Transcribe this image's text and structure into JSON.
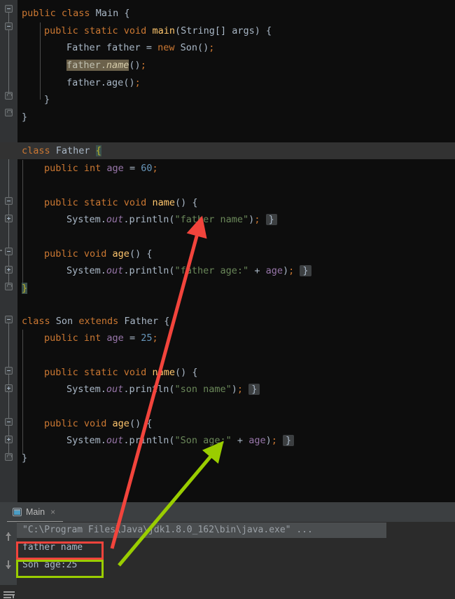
{
  "editor": {
    "language": "java",
    "background": "#0D0D0D",
    "gutter_background": "#313335",
    "current_line": "class Father {",
    "lines": [
      {
        "n": 1,
        "indent": 0,
        "text": "public class Main {"
      },
      {
        "n": 2,
        "indent": 1,
        "text": "public static void main(String[] args) {"
      },
      {
        "n": 3,
        "indent": 2,
        "text": "Father father = new Son();"
      },
      {
        "n": 4,
        "indent": 2,
        "text": "father.name();"
      },
      {
        "n": 5,
        "indent": 2,
        "text": "father.age();"
      },
      {
        "n": 6,
        "indent": 1,
        "text": "}"
      },
      {
        "n": 7,
        "indent": 0,
        "text": "}"
      },
      {
        "n": 8,
        "indent": 0,
        "text": ""
      },
      {
        "n": 9,
        "indent": 0,
        "text": "class Father {"
      },
      {
        "n": 10,
        "indent": 1,
        "text": "public int age = 60;"
      },
      {
        "n": 11,
        "indent": 0,
        "text": ""
      },
      {
        "n": 12,
        "indent": 1,
        "text": "public static void name() {"
      },
      {
        "n": 13,
        "indent": 2,
        "text": "System.out.println(\"father name\"); }"
      },
      {
        "n": 14,
        "indent": 0,
        "text": ""
      },
      {
        "n": 15,
        "indent": 1,
        "text": "public void age() {"
      },
      {
        "n": 16,
        "indent": 2,
        "text": "System.out.println(\"father age:\" + age); }"
      },
      {
        "n": 17,
        "indent": 0,
        "text": "}"
      },
      {
        "n": 18,
        "indent": 0,
        "text": ""
      },
      {
        "n": 19,
        "indent": 0,
        "text": "class Son extends Father {"
      },
      {
        "n": 20,
        "indent": 1,
        "text": "public int age = 25;"
      },
      {
        "n": 21,
        "indent": 0,
        "text": ""
      },
      {
        "n": 22,
        "indent": 1,
        "text": "public static void name() {"
      },
      {
        "n": 23,
        "indent": 2,
        "text": "System.out.println(\"son name\"); }"
      },
      {
        "n": 24,
        "indent": 0,
        "text": ""
      },
      {
        "n": 25,
        "indent": 1,
        "text": "public void age() {"
      },
      {
        "n": 26,
        "indent": 2,
        "text": "System.out.println(\"Son age:\" + age); }"
      },
      {
        "n": 27,
        "indent": 0,
        "text": "}"
      }
    ],
    "highlighted_token": "father.name",
    "field_values": {
      "father_age": "60",
      "son_age": "25"
    },
    "strings": [
      "father name",
      "father age:",
      "son name",
      "Son age:"
    ]
  },
  "console": {
    "tab_label": "Main",
    "tab_close_glyph": "×",
    "lines": [
      {
        "text": "\"C:\\Program Files\\Java\\jdk1.8.0_162\\bin\\java.exe\" ...",
        "kind": "system"
      },
      {
        "text": "father name",
        "kind": "output"
      },
      {
        "text": "Son age:25",
        "kind": "output"
      }
    ],
    "toolbar": [
      "up-arrow-icon",
      "down-arrow-icon",
      "soft-wrap-icon"
    ]
  },
  "annotations": {
    "red_color": "#F2443C",
    "green_color": "#9ACD00",
    "red_box_target": "father name",
    "green_box_target": "Son age:25",
    "red_arrow_from": "father name",
    "red_arrow_to": "System.out.println(\"father name\");",
    "green_arrow_from": "Son age:25",
    "green_arrow_to": "System.out.println(\"Son age:\" + age);"
  }
}
